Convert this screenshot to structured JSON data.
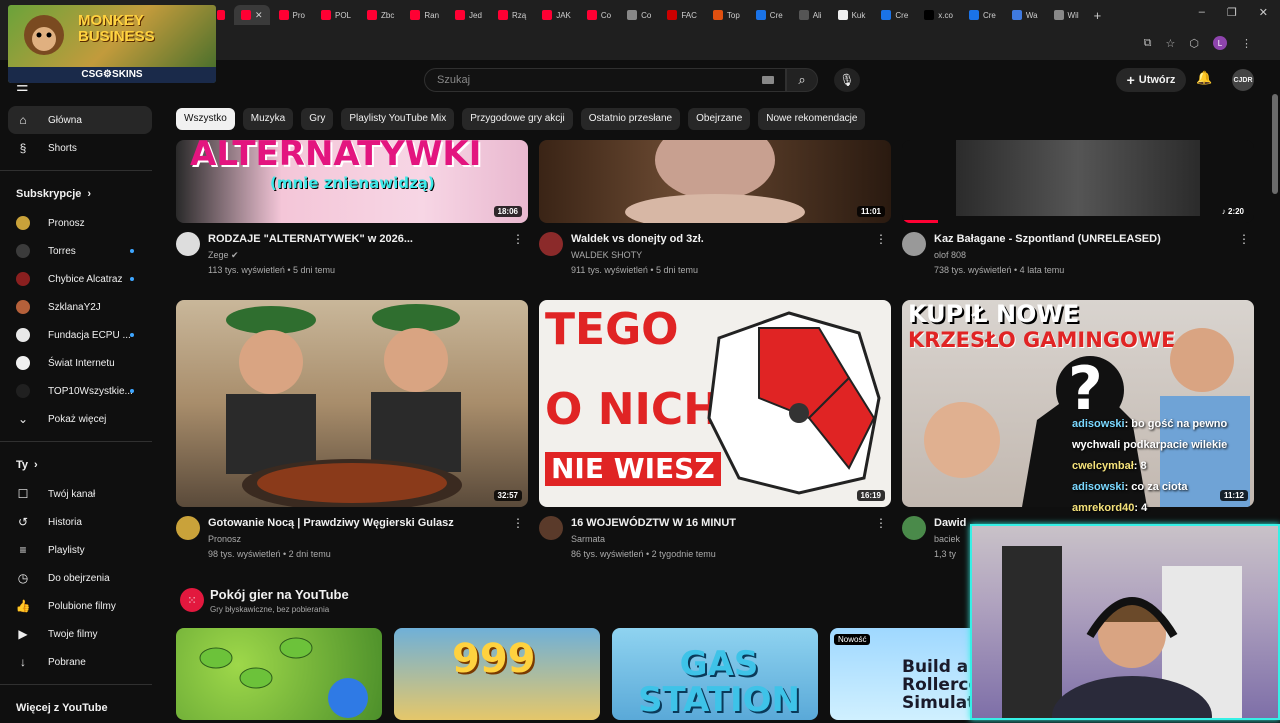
{
  "browser": {
    "tabs": [
      "Pro",
      "POL",
      "Zbc",
      "Ran",
      "Jed",
      "Rzą",
      "JAK",
      "Co",
      "Co",
      "FAC",
      "Top",
      "Cre",
      "Ali",
      "Kuk",
      "Cre",
      "x.co",
      "Cre",
      "Wa",
      "Wil"
    ],
    "profile": "L",
    "win": {
      "minimize": "–",
      "restore": "❐",
      "close": "✕"
    }
  },
  "overlay_banner": {
    "title_line1": "MONKEY",
    "title_line2": "BUSINESS",
    "footer": "CSG⚙SKINS"
  },
  "header": {
    "search_placeholder": "Szukaj",
    "create_label": "Utwórz",
    "avatar_text": "CJDR"
  },
  "chips": [
    "Wszystko",
    "Muzyka",
    "Gry",
    "Playlisty YouTube Mix",
    "Przygodowe gry akcji",
    "Ostatnio przesłane",
    "Obejrzane",
    "Nowe rekomendacje"
  ],
  "sidebar": {
    "main": [
      {
        "label": "Główna",
        "icon": "home-icon"
      },
      {
        "label": "Shorts",
        "icon": "shorts-icon"
      }
    ],
    "subs_title": "Subskrypcje",
    "subs": [
      {
        "label": "Pronosz",
        "color": "#c9a23a",
        "dot": false
      },
      {
        "label": "Torres",
        "color": "#3b3b3b",
        "dot": true
      },
      {
        "label": "Chybice Alcatraz",
        "color": "#8a1f1f",
        "dot": true
      },
      {
        "label": "SzklanaY2J",
        "color": "#b5603a",
        "dot": false
      },
      {
        "label": "Fundacja ECPU ...",
        "color": "#e8e8e8",
        "dot": true
      },
      {
        "label": "Świat Internetu",
        "color": "#f0f0f0",
        "dot": false
      },
      {
        "label": "TOP10Wszystkie...",
        "color": "#202020",
        "dot": true
      }
    ],
    "show_more": "Pokaż więcej",
    "you_title": "Ty",
    "you": [
      {
        "label": "Twój kanał",
        "icon": "channel-icon"
      },
      {
        "label": "Historia",
        "icon": "history-icon"
      },
      {
        "label": "Playlisty",
        "icon": "playlists-icon"
      },
      {
        "label": "Do obejrzenia",
        "icon": "watch-later-icon"
      },
      {
        "label": "Polubione filmy",
        "icon": "liked-icon"
      },
      {
        "label": "Twoje filmy",
        "icon": "your-videos-icon"
      },
      {
        "label": "Pobrane",
        "icon": "downloads-icon"
      }
    ],
    "more_title": "Więcej z YouTube"
  },
  "videos_row1": [
    {
      "title": "RODZAJE \"ALTERNATYWEK\" w 2026...",
      "channel": "Zege ✔",
      "stats": "113 tys. wyświetleń • 5 dni temu",
      "duration": "18:06",
      "thumb_text": "ALTERNATYWKI",
      "thumb_sub": "(mnie znienawidzą)"
    },
    {
      "title": "Waldek vs donejty od 3zł.",
      "channel": "WALDEK SHOTY",
      "stats": "911 tys. wyświetleń • 5 dni temu",
      "duration": "11:01"
    },
    {
      "title": "Kaz Bałagane - Szpontland (UNRELEASED)",
      "channel": "olof 808",
      "stats": "738 tys. wyświetleń • 4 lata temu",
      "duration": "♪ 2:20"
    }
  ],
  "videos_row2": [
    {
      "title": "Gotowanie Nocą | Prawdziwy Węgierski Gulasz",
      "channel": "Pronosz",
      "stats": "98 tys. wyświetleń • 2 dni temu",
      "duration": "32:57"
    },
    {
      "title": "16 WOJEWÓDZTW W 16 MINUT",
      "channel": "Sarmata",
      "stats": "86 tys. wyświetleń • 2 tygodnie temu",
      "duration": "16:19",
      "thumb_lines": [
        "TEGO",
        "O NICH",
        "NIE WIESZ"
      ]
    },
    {
      "title": "Dawid",
      "channel": "baciek",
      "stats": "1,3 ty",
      "duration": "11:12",
      "thumb_lines": [
        "KUPIŁ NOWE",
        "KRZESŁO GAMINGOWE"
      ],
      "thumb_q": "?"
    }
  ],
  "games": {
    "title": "Pokój gier na YouTube",
    "subtitle": "Gry błyskawiczne, bez pobierania",
    "items": [
      {
        "text": ""
      },
      {
        "text": "999"
      },
      {
        "text": "GAS STATION"
      },
      {
        "text": "Build a Rollercoaster Simulator",
        "badge": "Nowość"
      }
    ]
  },
  "chat": [
    {
      "nick": "adisowski",
      "msg": ": bo gość na pewno wychwali podkarpacie wilekie"
    },
    {
      "nick": "cwelcymbał",
      "msg": ": 8"
    },
    {
      "nick": "adisowski",
      "msg": ": co za ciota"
    },
    {
      "nick": "amrekord40",
      "msg": ": 4"
    }
  ]
}
